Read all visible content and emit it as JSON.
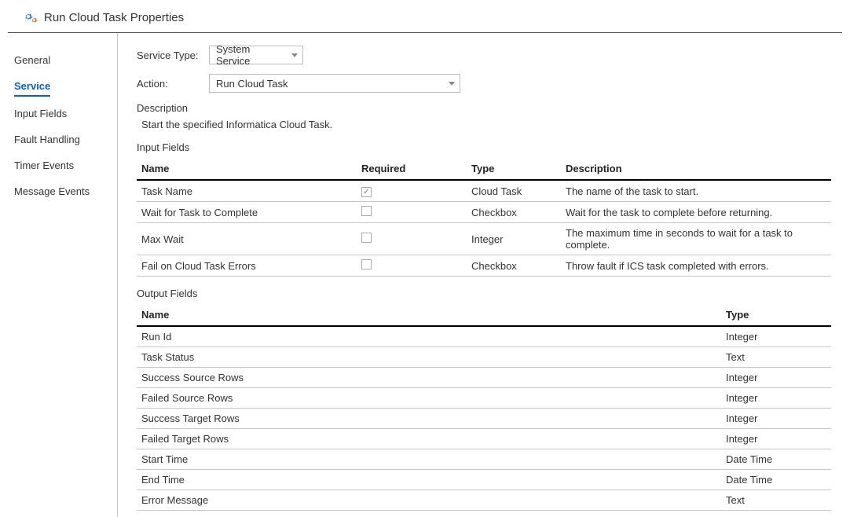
{
  "header": {
    "title": "Run Cloud Task Properties"
  },
  "sidebar": {
    "items": [
      {
        "label": "General"
      },
      {
        "label": "Service"
      },
      {
        "label": "Input Fields"
      },
      {
        "label": "Fault Handling"
      },
      {
        "label": "Timer Events"
      },
      {
        "label": "Message Events"
      }
    ],
    "activeIndex": 1
  },
  "form": {
    "serviceTypeLabel": "Service Type:",
    "serviceTypeValue": "System Service",
    "actionLabel": "Action:",
    "actionValue": "Run Cloud Task",
    "descriptionLabel": "Description",
    "descriptionText": "Start the specified Informatica Cloud Task."
  },
  "inputFields": {
    "title": "Input Fields",
    "headers": {
      "name": "Name",
      "required": "Required",
      "type": "Type",
      "description": "Description"
    },
    "rows": [
      {
        "name": "Task Name",
        "required": true,
        "type": "Cloud Task",
        "description": "The name of the task to start."
      },
      {
        "name": "Wait for Task to Complete",
        "required": false,
        "type": "Checkbox",
        "description": "Wait for the task to complete before returning."
      },
      {
        "name": "Max Wait",
        "required": false,
        "type": "Integer",
        "description": "The maximum time in seconds to wait for a task to complete."
      },
      {
        "name": "Fail on Cloud Task Errors",
        "required": false,
        "type": "Checkbox",
        "description": "Throw fault if ICS task completed with errors."
      }
    ]
  },
  "outputFields": {
    "title": "Output Fields",
    "headers": {
      "name": "Name",
      "type": "Type"
    },
    "rows": [
      {
        "name": "Run Id",
        "type": "Integer"
      },
      {
        "name": "Task Status",
        "type": "Text"
      },
      {
        "name": "Success Source Rows",
        "type": "Integer"
      },
      {
        "name": "Failed Source Rows",
        "type": "Integer"
      },
      {
        "name": "Success Target Rows",
        "type": "Integer"
      },
      {
        "name": "Failed Target Rows",
        "type": "Integer"
      },
      {
        "name": "Start Time",
        "type": "Date Time"
      },
      {
        "name": "End Time",
        "type": "Date Time"
      },
      {
        "name": "Error Message",
        "type": "Text"
      }
    ]
  }
}
